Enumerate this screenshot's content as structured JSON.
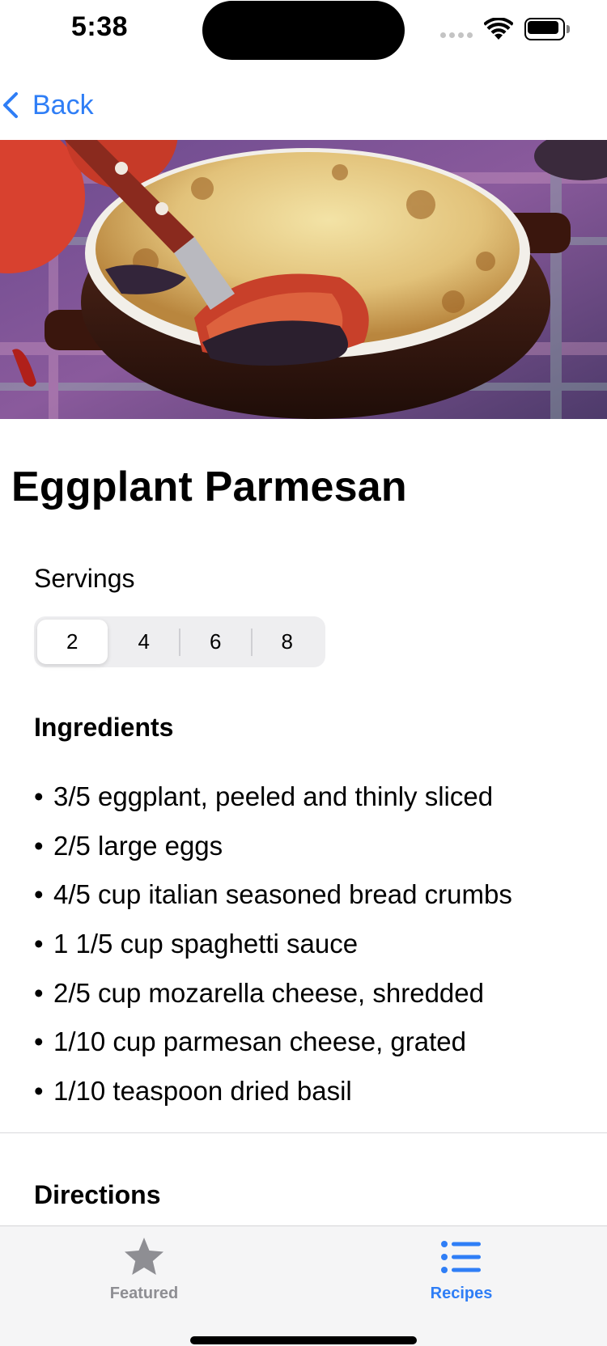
{
  "status_bar": {
    "time": "5:38"
  },
  "nav": {
    "back_label": "Back"
  },
  "recipe": {
    "title": "Eggplant Parmesan",
    "hero_image_icon": "eggplant-parmesan-photo"
  },
  "servings": {
    "label": "Servings",
    "options": [
      "2",
      "4",
      "6",
      "8"
    ],
    "selected": "2"
  },
  "ingredients": {
    "heading": "Ingredients",
    "bullet": "•",
    "items": [
      "3/5 eggplant, peeled and thinly sliced",
      "2/5 large eggs",
      "4/5 cup italian seasoned bread crumbs",
      "1 1/5 cup spaghetti sauce",
      "2/5 cup mozarella cheese, shredded",
      "1/10 cup parmesan cheese, grated",
      "1/10 teaspoon dried basil"
    ]
  },
  "directions": {
    "heading": "Directions"
  },
  "tab_bar": {
    "tabs": [
      {
        "label": "Featured",
        "icon": "star-icon",
        "active": false
      },
      {
        "label": "Recipes",
        "icon": "list-icon",
        "active": true
      }
    ]
  },
  "colors": {
    "accent": "#2f7ef6",
    "inactive_tab": "#8e8e93"
  }
}
